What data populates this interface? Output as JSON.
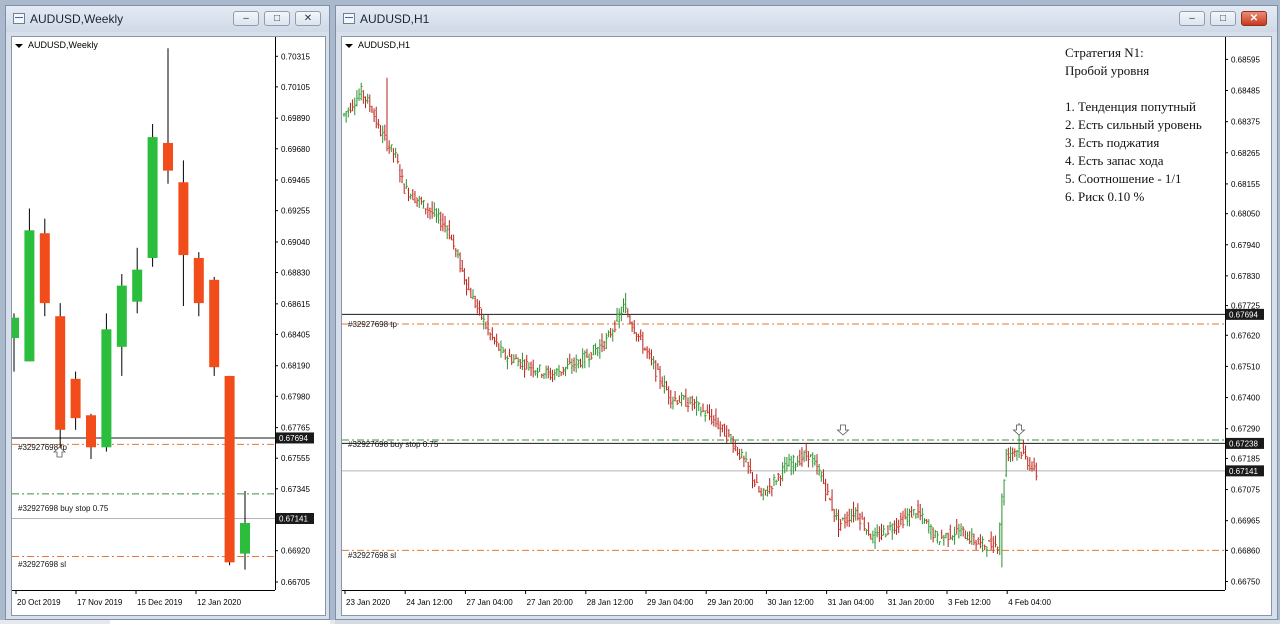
{
  "colors": {
    "bull": "#2bbd3c",
    "bear": "#f24c1a",
    "tp_line": "#1a1a1a",
    "current": "#b4b4b4",
    "sl_line": "#e07a3a",
    "buy_line": "#3f8f3f"
  },
  "window_weekly": {
    "title": "AUDUSD,Weekly",
    "chart_label": "AUDUSD,Weekly",
    "order_tp": "#32927698 tp",
    "order_buy": "#32927698 buy stop 0.75",
    "order_sl": "#32927698 sl",
    "price_tags": [
      {
        "text": "0.67694",
        "bg": "#1a1a1a"
      },
      {
        "text": "0.67141",
        "bg": "#1a1a1a"
      }
    ],
    "price_axis": [
      "0.70315",
      "0.70105",
      "0.69890",
      "0.69680",
      "0.69465",
      "0.69255",
      "0.69040",
      "0.68830",
      "0.68615",
      "0.68405",
      "0.68190",
      "0.67980",
      "0.67765",
      "0.67555",
      "0.67345",
      "0.67130",
      "0.66920",
      "0.66705"
    ],
    "time_axis": [
      "20 Oct 2019",
      "17 Nov 2019",
      "15 Dec 2019",
      "12 Jan 2020"
    ],
    "buttons": {
      "minimize": "–",
      "restore": "□",
      "close": "✕"
    }
  },
  "window_hourly": {
    "title": "AUDUSD,H1",
    "chart_label": "AUDUSD,H1",
    "order_tp": "#32927698 tp",
    "order_buy": "#32927698 buy stop 0.75",
    "order_sl": "#32927698 sl",
    "strategy": {
      "title": "Стратегия N1:",
      "subtitle": "Пробой уровня",
      "items": [
        "1. Тенденция попутный",
        "2. Есть сильный уровень",
        "3. Есть поджатия",
        "4. Есть запас хода",
        "5. Соотношение - 1/1",
        "6. Риск 0.10 %"
      ]
    },
    "price_tags": [
      {
        "text": "0.67694",
        "bg": "#1a1a1a"
      },
      {
        "text": "0.67238",
        "bg": "#1a1a1a"
      },
      {
        "text": "0.67141",
        "bg": "#1a1a1a"
      }
    ],
    "price_axis": [
      "0.68595",
      "0.68485",
      "0.68375",
      "0.68265",
      "0.68155",
      "0.68050",
      "0.67940",
      "0.67830",
      "0.67725",
      "0.67620",
      "0.67510",
      "0.67400",
      "0.67290",
      "0.67185",
      "0.67075",
      "0.66965",
      "0.66860",
      "0.66750"
    ],
    "time_axis": [
      "23 Jan 2020",
      "24 Jan 12:00",
      "27 Jan 04:00",
      "27 Jan 20:00",
      "28 Jan 12:00",
      "29 Jan 04:00",
      "29 Jan 20:00",
      "30 Jan 12:00",
      "31 Jan 04:00",
      "31 Jan 20:00",
      "3 Feb 12:00",
      "4 Feb 04:00"
    ],
    "buttons": {
      "minimize": "–",
      "restore": "□",
      "close": "✕"
    }
  },
  "chart_data": [
    {
      "type": "candlestick",
      "title": "AUDUSD,Weekly",
      "ylim": [
        0.6665,
        0.7042
      ],
      "x": [
        "20 Oct 2019",
        "17 Nov 2019",
        "15 Dec 2019",
        "12 Jan 2020"
      ],
      "levels": {
        "tp": 0.67694,
        "buy_stop": 0.6731,
        "sl": 0.6688,
        "current": 0.67141,
        "tp_dashed": 0.6765
      },
      "candles": [
        {
          "o": 0.6838,
          "h": 0.6855,
          "l": 0.6815,
          "c": 0.6852
        },
        {
          "o": 0.6822,
          "h": 0.6927,
          "l": 0.6822,
          "c": 0.6912
        },
        {
          "o": 0.691,
          "h": 0.692,
          "l": 0.6853,
          "c": 0.6862
        },
        {
          "o": 0.6853,
          "h": 0.6862,
          "l": 0.6762,
          "c": 0.6775
        },
        {
          "o": 0.681,
          "h": 0.6815,
          "l": 0.6775,
          "c": 0.6783
        },
        {
          "o": 0.6785,
          "h": 0.6786,
          "l": 0.6755,
          "c": 0.6763
        },
        {
          "o": 0.6763,
          "h": 0.6855,
          "l": 0.676,
          "c": 0.6844
        },
        {
          "o": 0.6832,
          "h": 0.6882,
          "l": 0.6812,
          "c": 0.6874
        },
        {
          "o": 0.6863,
          "h": 0.69,
          "l": 0.6855,
          "c": 0.6885
        },
        {
          "o": 0.6893,
          "h": 0.6985,
          "l": 0.6887,
          "c": 0.6976
        },
        {
          "o": 0.6972,
          "h": 0.7037,
          "l": 0.6944,
          "c": 0.6953
        },
        {
          "o": 0.6945,
          "h": 0.696,
          "l": 0.686,
          "c": 0.6895
        },
        {
          "o": 0.6893,
          "h": 0.6897,
          "l": 0.6853,
          "c": 0.6862
        },
        {
          "o": 0.6878,
          "h": 0.688,
          "l": 0.6812,
          "c": 0.6818
        },
        {
          "o": 0.6812,
          "h": 0.6812,
          "l": 0.6682,
          "c": 0.6684
        },
        {
          "o": 0.669,
          "h": 0.6733,
          "l": 0.6679,
          "c": 0.6711
        }
      ]
    },
    {
      "type": "candlestick",
      "title": "AUDUSD,H1",
      "ylim": [
        0.6672,
        0.6866
      ],
      "x": [
        "23 Jan 2020",
        "24 Jan 12:00",
        "27 Jan 04:00",
        "27 Jan 20:00",
        "28 Jan 12:00",
        "29 Jan 04:00",
        "29 Jan 20:00",
        "30 Jan 12:00",
        "31 Jan 04:00",
        "31 Jan 20:00",
        "3 Feb 12:00",
        "4 Feb 04:00"
      ],
      "levels": {
        "tp": 0.67694,
        "buy_stop": 0.67238,
        "sl": 0.6686,
        "current": 0.67141,
        "tp_dashed": 0.6766,
        "buy_dashed": 0.6725
      },
      "anchors": [
        {
          "i": 0,
          "p": 0.684
        },
        {
          "i": 8,
          "p": 0.6848
        },
        {
          "i": 13,
          "p": 0.6842
        },
        {
          "i": 16,
          "p": 0.6835
        },
        {
          "i": 24,
          "p": 0.6825
        },
        {
          "i": 28,
          "p": 0.6814
        },
        {
          "i": 40,
          "p": 0.6806
        },
        {
          "i": 48,
          "p": 0.68
        },
        {
          "i": 58,
          "p": 0.6778
        },
        {
          "i": 68,
          "p": 0.6762
        },
        {
          "i": 74,
          "p": 0.6755
        },
        {
          "i": 84,
          "p": 0.6752
        },
        {
          "i": 96,
          "p": 0.6748
        },
        {
          "i": 110,
          "p": 0.6753
        },
        {
          "i": 122,
          "p": 0.676
        },
        {
          "i": 130,
          "p": 0.6772
        },
        {
          "i": 138,
          "p": 0.676
        },
        {
          "i": 146,
          "p": 0.6748
        },
        {
          "i": 152,
          "p": 0.674
        },
        {
          "i": 162,
          "p": 0.6738
        },
        {
          "i": 172,
          "p": 0.6732
        },
        {
          "i": 180,
          "p": 0.6725
        },
        {
          "i": 188,
          "p": 0.6715
        },
        {
          "i": 194,
          "p": 0.6705
        },
        {
          "i": 206,
          "p": 0.6716
        },
        {
          "i": 216,
          "p": 0.672
        },
        {
          "i": 222,
          "p": 0.6712
        },
        {
          "i": 230,
          "p": 0.6695
        },
        {
          "i": 238,
          "p": 0.67
        },
        {
          "i": 246,
          "p": 0.669
        },
        {
          "i": 256,
          "p": 0.6695
        },
        {
          "i": 266,
          "p": 0.67
        },
        {
          "i": 276,
          "p": 0.669
        },
        {
          "i": 286,
          "p": 0.6693
        },
        {
          "i": 296,
          "p": 0.6688
        },
        {
          "i": 304,
          "p": 0.6688
        },
        {
          "i": 308,
          "p": 0.672
        },
        {
          "i": 314,
          "p": 0.6722
        },
        {
          "i": 322,
          "p": 0.6713
        }
      ]
    }
  ]
}
